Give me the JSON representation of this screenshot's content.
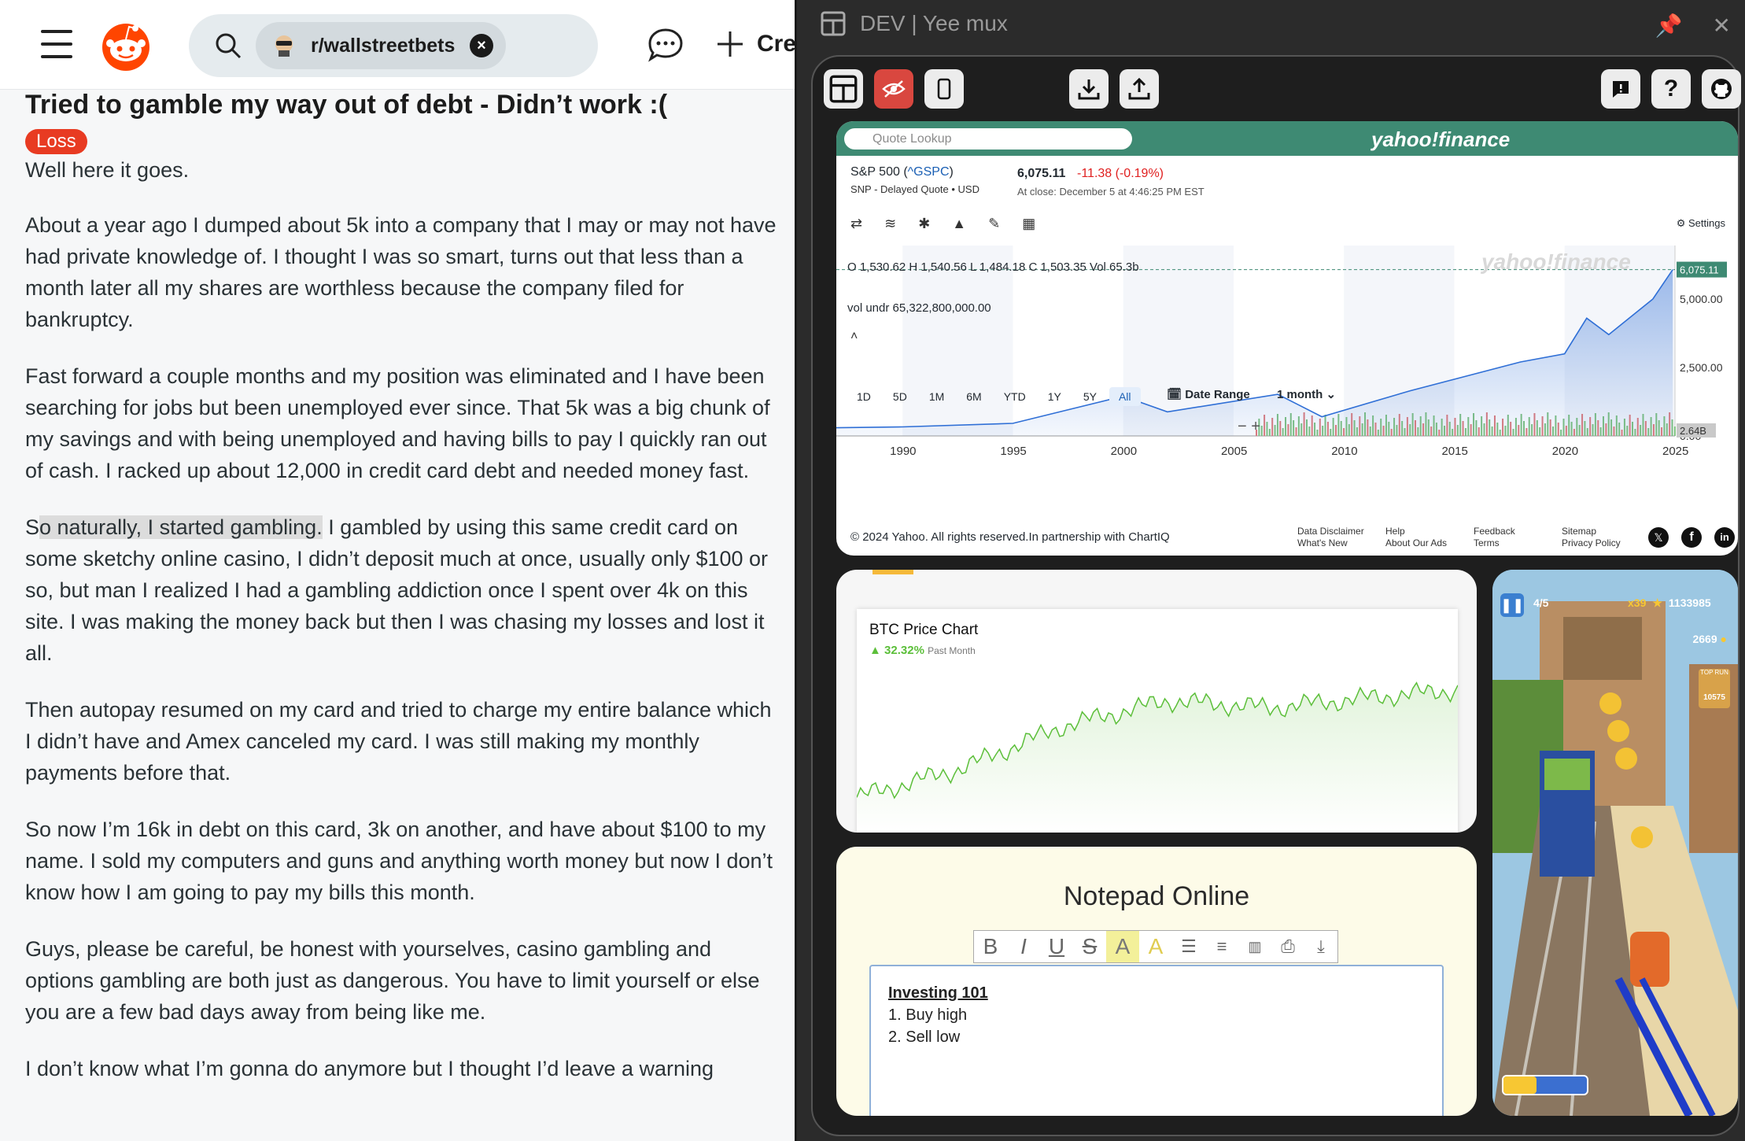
{
  "reddit": {
    "subreddit": "r/wallstreetbets",
    "create_label": "Cre",
    "post_title": "Tried to gamble my way out of debt - Didn’t work :(",
    "flair": "Loss",
    "paragraphs": [
      "Well here it goes.",
      "About a year ago I dumped about 5k into a company that I may or may not have had private knowledge of. I thought I was so smart, turns out that less than a month later all my shares are worthless because the company filed for bankruptcy.",
      "Fast forward a couple months and my position was eliminated and I have been searching for jobs but been unemployed ever since. That 5k was a big chunk of my savings and with being unemployed and having bills to pay I quickly ran out of cash. I racked up about 12,000 in credit card debt and needed money fast.",
      "I gambled by using this same credit card on some sketchy online casino, I didn’t deposit much at once, usually only $100 or so, but man I realized I had a gambling addiction once I spent over 4k on this site. I was making the money back but then I was chasing my losses and lost it all.",
      "Then autopay resumed on my card and tried to charge my entire balance which I didn’t have and Amex canceled my card. I was still making my monthly payments before that.",
      "So now I’m 16k in debt on this card, 3k on another, and have about $100 to my name. I sold my computers and guns and anything worth money but now I don’t know how I am going to pay my bills this month.",
      "Guys, please be careful, be honest with yourselves, casino gambling and options gambling are both just as dangerous. You have to limit yourself or else you are a few bad days away from being like me.",
      "I don’t know what I’m gonna do anymore but I thought I’d leave a warning"
    ],
    "p4_prefix": "S",
    "p4_highlight": "o naturally, I started gambling.",
    "colors": {
      "flair": "#e83b22",
      "brand": "#ff4500"
    }
  },
  "app": {
    "title": "DEV | Yee mux",
    "pin_icon": "pin-icon",
    "close_icon": "close-icon"
  },
  "yahoo": {
    "search_placeholder": "Quote Lookup",
    "brand": "yahoo!finance",
    "symbol_name": "S&P 500 (",
    "symbol_code": "^GSPC",
    "symbol_close_paren": ")",
    "quote_meta": "SNP - Delayed Quote • USD",
    "price": "6,075.11",
    "change": "-11.38",
    "change_pct": "(-0.19%)",
    "close_time": "At close: December 5 at 4:46:25 PM EST",
    "settings": "Settings",
    "ohlc": "O 1,530.62  H 1,540.56  L 1,484.18  C 1,503.35  Vol 65.3b",
    "vol_label": "vol undr  65,322,800,000.00",
    "last_label": "6,075.11",
    "vol_badge": "2.64B",
    "y_ticks": [
      "5,000.00",
      "2,500.00",
      "0.00"
    ],
    "x_ticks": [
      "1990",
      "1995",
      "2000",
      "2005",
      "2010",
      "2015",
      "2020",
      "2025"
    ],
    "ranges": [
      "1D",
      "5D",
      "1M",
      "6M",
      "YTD",
      "1Y",
      "5Y",
      "All"
    ],
    "date_range": "Date Range",
    "interval": "1 month",
    "footer_copy": "© 2024 Yahoo. All rights reserved.In partnership with ChartIQ",
    "footer_links": [
      [
        "Data Disclaimer",
        "What's New"
      ],
      [
        "Help",
        "About Our Ads"
      ],
      [
        "Feedback",
        "Terms"
      ],
      [
        "Sitemap",
        "Privacy Policy"
      ]
    ],
    "colors": {
      "bar": "#3e8a73",
      "down": "#e02020",
      "area": "#2f6fd6"
    }
  },
  "btc": {
    "title": "BTC Price Chart",
    "change": "32.32%",
    "period": "Past Month",
    "color": "#5cbf3a"
  },
  "game": {
    "stage": "4/5",
    "multiplier": "x39",
    "score": "1133985",
    "coins": "2669",
    "top_run_label": "TOP RUN",
    "top_run": "10575"
  },
  "notepad": {
    "title": "Notepad Online",
    "toolbar": [
      "B",
      "I",
      "U",
      "S",
      "A",
      "A"
    ],
    "heading": "Investing 101",
    "lines": [
      "1. Buy high",
      "2. Sell low"
    ]
  },
  "chart_data": [
    {
      "type": "area",
      "title": "S&P 500 (^GSPC)",
      "x": [
        1987,
        1990,
        1995,
        2000,
        2002,
        2007,
        2009,
        2013,
        2018,
        2020,
        2021,
        2022,
        2024,
        2024.9
      ],
      "values": [
        300,
        330,
        460,
        1450,
        880,
        1520,
        700,
        1650,
        2700,
        3000,
        4300,
        3700,
        5000,
        6075
      ],
      "xlim": [
        1987,
        2025
      ],
      "ylim": [
        0,
        6075
      ],
      "xlabel": "",
      "ylabel": ""
    },
    {
      "type": "line",
      "title": "BTC Price Chart",
      "x": [
        0,
        5,
        10,
        15,
        20,
        25,
        29
      ],
      "values": [
        70000,
        78000,
        90000,
        97000,
        95000,
        98000,
        100000
      ],
      "xlabel": "",
      "ylabel": ""
    }
  ]
}
